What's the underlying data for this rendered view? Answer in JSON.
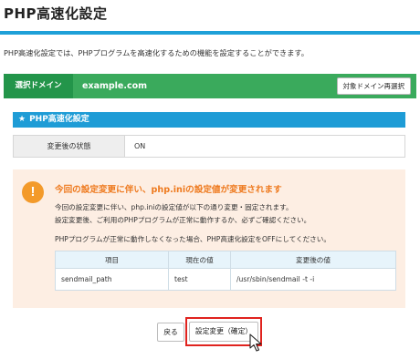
{
  "page": {
    "title": "PHP高速化設定",
    "description": "PHP高速化設定では、PHPプログラムを高速化するための機能を設定することができます。"
  },
  "domain_bar": {
    "label": "選択ドメイン",
    "value": "example.com",
    "change_button": "対象ドメイン再選択"
  },
  "section": {
    "star_icon": "★",
    "title": "PHP高速化設定"
  },
  "status": {
    "label": "変更後の状態",
    "value": "ON"
  },
  "warning": {
    "icon": "!",
    "title": "今回の設定変更に伴い、php.iniの設定値が変更されます",
    "lines": [
      "今回の設定変更に伴い、php.iniの設定値が以下の通り変更・固定されます。",
      "設定変更後、ご利用のPHPプログラムが正常に動作するか、必ずご確認ください。",
      "PHPプログラムが正常に動作しなくなった場合、PHP高速化設定をOFFにしてください。"
    ],
    "table": {
      "headers": [
        "項目",
        "現在の値",
        "変更後の値"
      ],
      "rows": [
        [
          "sendmail_path",
          "test",
          "/usr/sbin/sendmail -t -i"
        ]
      ]
    }
  },
  "actions": {
    "back": "戻る",
    "confirm": "設定変更（確定）"
  },
  "colors": {
    "accent_blue": "#1e9cd6",
    "domain_green": "#3aaa5c",
    "warning_orange": "#ee7a1f",
    "highlight_red": "#e0231e"
  }
}
